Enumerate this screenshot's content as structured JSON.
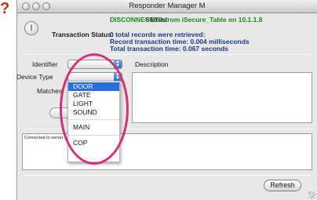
{
  "annotation": {
    "mark": "?"
  },
  "window": {
    "title": "Responder Manager M"
  },
  "status": {
    "label": "Status:",
    "value": "DISCONNECTED from iSecure_Table on 10.1.1.8"
  },
  "transaction": {
    "label": "Transaction Status:",
    "line1": "0 total records were retrieved:",
    "line2": "Record transaction time: 0.004 milliseconds",
    "line3": "Total transaction time: 0.067 seconds"
  },
  "form": {
    "identifier_label": "Identifier",
    "device_type_label": "Device Type",
    "matches_label": "Matches",
    "description_label": "Description"
  },
  "device_menu": {
    "items": [
      "DOOR",
      "GATE",
      "LIGHT",
      "SOUND",
      "MAIN",
      "COP"
    ],
    "selected": "DOOR"
  },
  "log": {
    "text": "Connected to server ............................. in 0 locks"
  },
  "buttons": {
    "refresh": "Refresh"
  }
}
